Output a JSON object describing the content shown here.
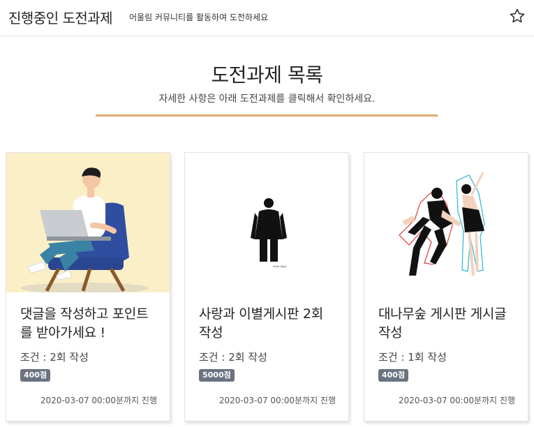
{
  "header": {
    "title": "진행중인 도전과제",
    "subtitle": "어울림 커뮤니티를 활동하여 도전하세요",
    "favorite_icon": "star-outline-icon"
  },
  "section": {
    "title": "도전과제 목록",
    "subtitle": "자세한 사항은 아래 도전과제를 클릭해서 확인하세요.",
    "accent_color": "#e3ab72"
  },
  "cards": [
    {
      "image": "man-with-laptop-on-armchair-illustration",
      "title": "댓글을 작성하고 포인트를 받아가세요 !",
      "condition": "조건 : 2회 작성",
      "points": "400점",
      "deadline": "2020-03-07 00:00분까지 진행"
    },
    {
      "image": "man-in-suit-back-view-illustration",
      "title": "사랑과 이별게시판 2회 작성",
      "condition": "조건 : 2회 작성",
      "points": "5000점",
      "deadline": "2020-03-07 00:00분까지 진행"
    },
    {
      "image": "dancing-couple-illustration",
      "title": "대나무숲 게시판 게시글작성",
      "condition": "조건 : 1회 작성",
      "points": "400점",
      "deadline": "2020-03-07 00:00분까지 진행"
    }
  ]
}
